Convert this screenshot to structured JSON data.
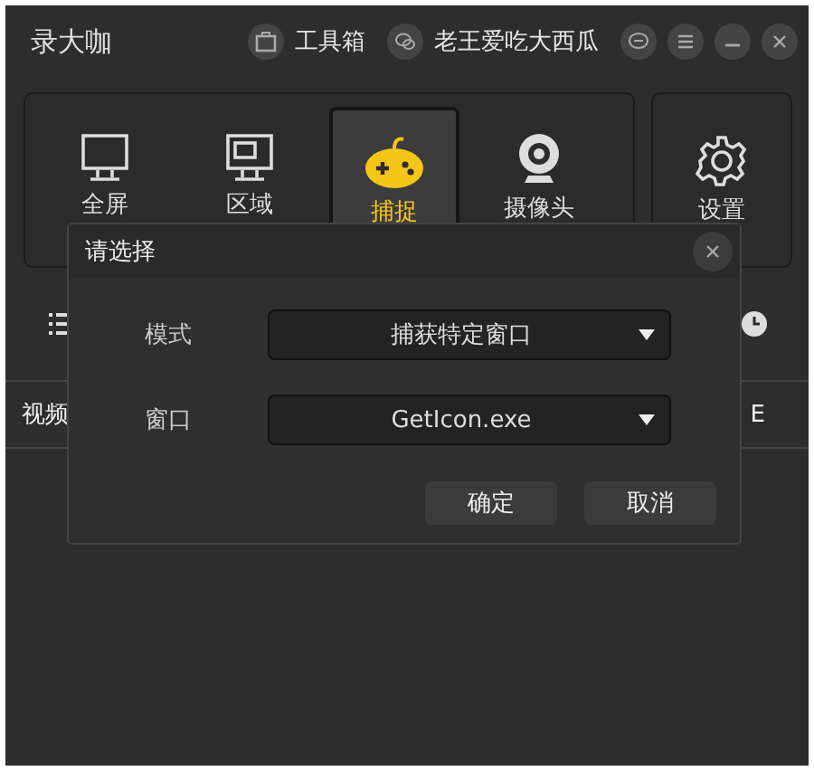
{
  "app": {
    "title": "录大咖",
    "toolbox": "工具箱",
    "user": "老王爱吃大西瓜"
  },
  "modes": [
    {
      "label": "全屏",
      "selected": false
    },
    {
      "label": "区域",
      "selected": false
    },
    {
      "label": "捕捉",
      "selected": true
    },
    {
      "label": "摄像头",
      "selected": false
    }
  ],
  "settings": {
    "label": "设置"
  },
  "table": {
    "columns": [
      "视频",
      "E"
    ]
  },
  "dialog": {
    "title": "请选择",
    "fields": [
      {
        "label": "模式",
        "value": "捕获特定窗口"
      },
      {
        "label": "窗口",
        "value": "GetIcon.exe"
      }
    ],
    "buttons": [
      "确定",
      "取消"
    ]
  }
}
